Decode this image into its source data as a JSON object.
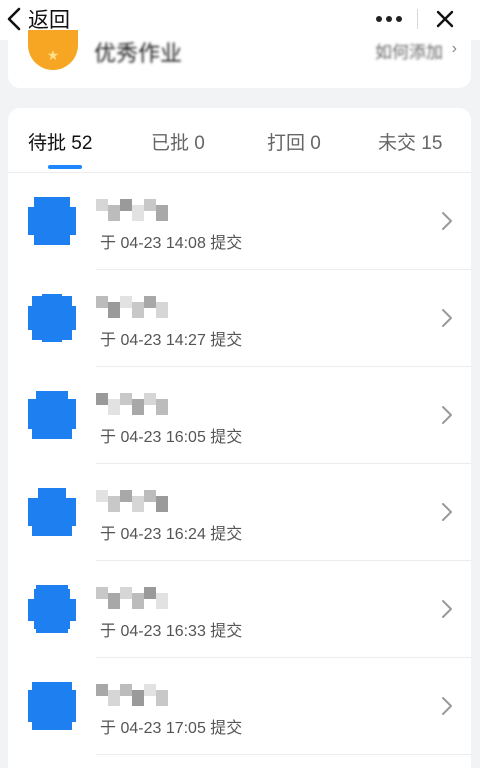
{
  "topbar": {
    "back_label": "返回",
    "back_icon": "chevron-left-icon",
    "more_icon": "more-dots-icon",
    "close_icon": "close-icon"
  },
  "header_card": {
    "icon": "medal-icon",
    "title": "优秀作业",
    "link": "如何添加"
  },
  "tabs": [
    {
      "label": "待批 52",
      "active": true
    },
    {
      "label": "已批 0",
      "active": false
    },
    {
      "label": "打回 0",
      "active": false
    },
    {
      "label": "未交 15",
      "active": false
    }
  ],
  "submissions": [
    {
      "time": "于 04-23 14:08 提交"
    },
    {
      "time": "于 04-23 14:27 提交"
    },
    {
      "time": "于 04-23 16:05 提交"
    },
    {
      "time": "于 04-23 16:24 提交"
    },
    {
      "time": "于 04-23 16:33 提交"
    },
    {
      "time": "于 04-23 17:05 提交"
    }
  ],
  "colors": {
    "accent": "#1e86ff",
    "avatar": "#1e7ff0",
    "medal": "#f6a623",
    "background": "#f2f3f5"
  }
}
